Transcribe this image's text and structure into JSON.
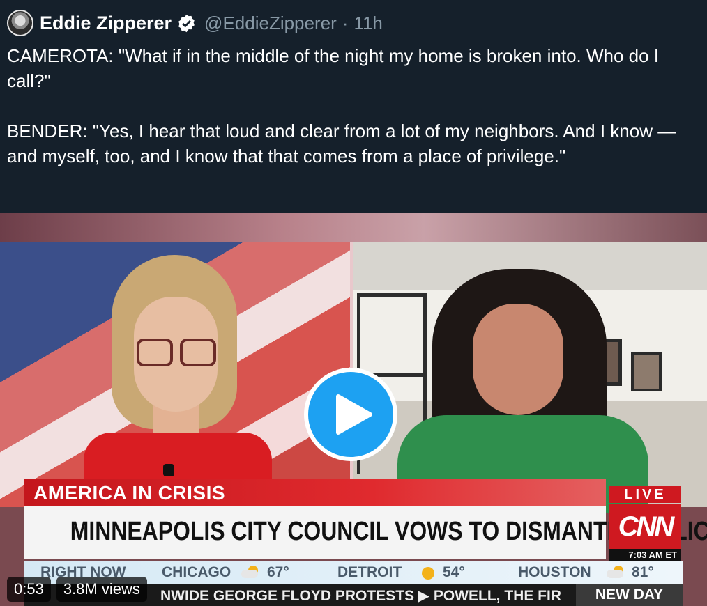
{
  "tweet": {
    "author_name": "Eddie Zipperer",
    "handle": "@EddieZipperer",
    "separator": "·",
    "time": "11h",
    "text": "CAMEROTA: \"What if in the middle of the night my home is broken into. Who do I call?\"\n\nBENDER: \"Yes, I hear that loud and clear from a lot of my neighbors. And I know — and myself, too, and I know that that comes from a place of privilege.\""
  },
  "video": {
    "duration": "0:53",
    "views": "3.8M views",
    "lower_third_label": "AMERICA IN CRISIS",
    "headline": "MINNEAPOLIS CITY COUNCIL VOWS TO DISMANTLE POLICE DEPT.",
    "live_label": "LIVE",
    "network": "CNN",
    "timestamp": "7:03 AM ET",
    "weather": {
      "prefix": "RIGHT NOW",
      "cities": [
        {
          "city": "CHICAGO",
          "temp": "67°",
          "icon": "partly-cloudy-icon"
        },
        {
          "city": "DETROIT",
          "temp": "54°",
          "icon": "sun-icon"
        },
        {
          "city": "HOUSTON",
          "temp": "81°",
          "icon": "partly-cloudy-icon"
        }
      ]
    },
    "ticker": "NWIDE GEORGE FLOYD PROTESTS  ▶  POWELL, THE FIR",
    "show": "NEW DAY"
  },
  "colors": {
    "background": "#15202b",
    "secondary_text": "#8899a6",
    "play_button": "#1da1f2",
    "cnn_red": "#cf1920"
  }
}
